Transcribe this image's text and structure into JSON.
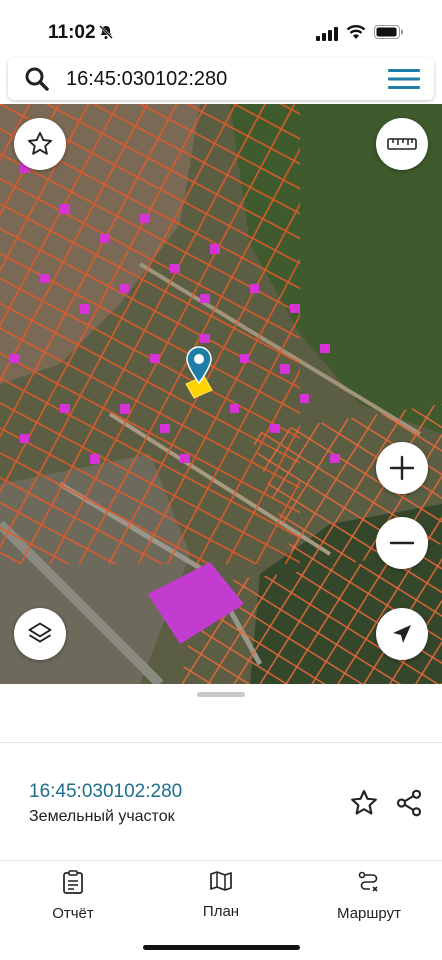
{
  "status_bar": {
    "time": "11:02"
  },
  "search": {
    "query": "16:45:030102:280"
  },
  "map": {
    "pin_color": "#1f7ea8",
    "selected_parcel_color": "#ffd400",
    "parcel_outline_color": "#e05a2a",
    "building_color": "#d633d6"
  },
  "parcel_card": {
    "cadastral_number": "16:45:030102:280",
    "type": "Земельный участок"
  },
  "tabs": [
    {
      "label": "Отчёт",
      "icon": "report-icon"
    },
    {
      "label": "План",
      "icon": "map-icon"
    },
    {
      "label": "Маршрут",
      "icon": "route-icon"
    }
  ]
}
